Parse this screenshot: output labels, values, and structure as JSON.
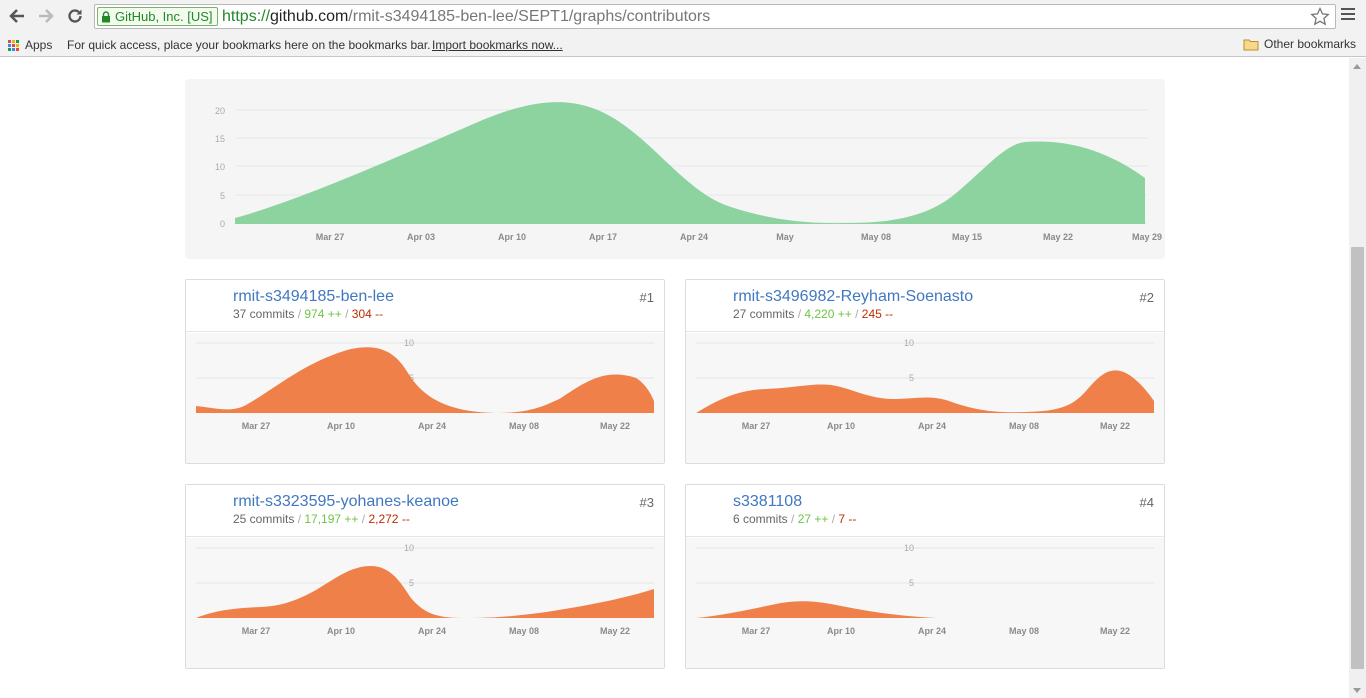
{
  "browser": {
    "ev_label": "GitHub, Inc. [US]",
    "url_scheme": "https://",
    "url_host": "github.com",
    "url_path": "/rmit-s3494185-ben-lee/SEPT1/graphs/contributors",
    "apps_label": "Apps",
    "bookmarks_hint": "For quick access, place your bookmarks here on the bookmarks bar.",
    "import_link": "Import bookmarks now...",
    "other_bookmarks": "Other bookmarks"
  },
  "colors": {
    "main_area": "#8cd3a0",
    "contributor_area": "#f0804a",
    "link": "#4078c0",
    "additions": "#6cc644",
    "deletions": "#bd2c00"
  },
  "main_graph": {
    "x_labels": [
      "Mar 27",
      "Apr 03",
      "Apr 10",
      "Apr 17",
      "Apr 24",
      "May",
      "May 08",
      "May 15",
      "May 22",
      "May 29"
    ],
    "y_labels": [
      "20",
      "15",
      "10",
      "5",
      "0"
    ]
  },
  "contributors": [
    {
      "rank": "#1",
      "name": "rmit-s3494185-ben-lee",
      "commits": "37 commits",
      "additions": "974 ++",
      "deletions": "304 --",
      "avatar": "identicon-mint-icon"
    },
    {
      "rank": "#2",
      "name": "rmit-s3496982-Reyham-Soenasto",
      "commits": "27 commits",
      "additions": "4,220 ++",
      "deletions": "245 --",
      "avatar": "skull-icon"
    },
    {
      "rank": "#3",
      "name": "rmit-s3323595-yohanes-keanoe",
      "commits": "25 commits",
      "additions": "17,197 ++",
      "deletions": "2,272 --",
      "avatar": "red-chevron-icon"
    },
    {
      "rank": "#4",
      "name": "s3381108",
      "commits": "6 commits",
      "additions": "27 ++",
      "deletions": "7 --",
      "avatar": "identicon-blue-icon"
    }
  ],
  "mini_graph": {
    "x_labels": [
      "Mar 27",
      "Apr 10",
      "Apr 24",
      "May 08",
      "May 22"
    ],
    "y_labels": [
      "10",
      "5"
    ]
  },
  "sep": " / "
}
